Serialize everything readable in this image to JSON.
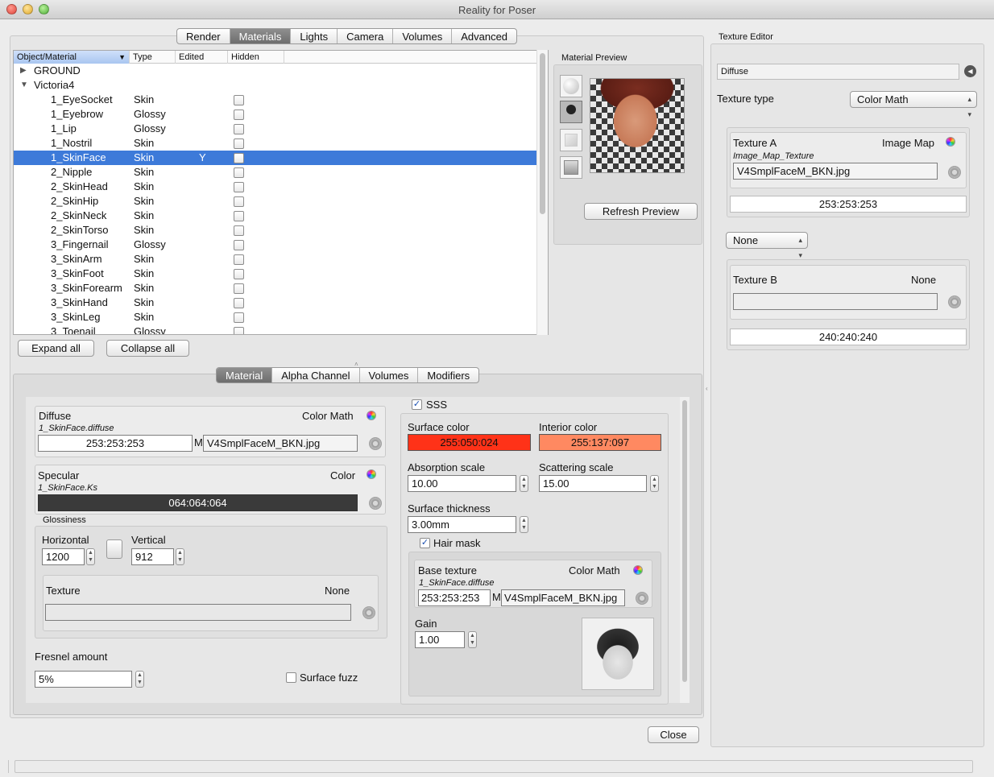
{
  "window": {
    "title": "Reality for Poser"
  },
  "top_tabs": [
    "Render",
    "Materials",
    "Lights",
    "Camera",
    "Volumes",
    "Advanced"
  ],
  "top_tabs_active": "Materials",
  "table": {
    "headers": [
      "Object/Material",
      "Type",
      "Edited",
      "Hidden"
    ],
    "groups": [
      {
        "name": "GROUND",
        "expanded": false
      },
      {
        "name": "Victoria4",
        "expanded": true
      }
    ],
    "rows": [
      {
        "name": "1_EyeSocket",
        "type": "Skin",
        "edited": ""
      },
      {
        "name": "1_Eyebrow",
        "type": "Glossy",
        "edited": ""
      },
      {
        "name": "1_Lip",
        "type": "Glossy",
        "edited": ""
      },
      {
        "name": "1_Nostril",
        "type": "Skin",
        "edited": ""
      },
      {
        "name": "1_SkinFace",
        "type": "Skin",
        "edited": "Y",
        "selected": true
      },
      {
        "name": "2_Nipple",
        "type": "Skin",
        "edited": ""
      },
      {
        "name": "2_SkinHead",
        "type": "Skin",
        "edited": ""
      },
      {
        "name": "2_SkinHip",
        "type": "Skin",
        "edited": ""
      },
      {
        "name": "2_SkinNeck",
        "type": "Skin",
        "edited": ""
      },
      {
        "name": "2_SkinTorso",
        "type": "Skin",
        "edited": ""
      },
      {
        "name": "3_Fingernail",
        "type": "Glossy",
        "edited": ""
      },
      {
        "name": "3_SkinArm",
        "type": "Skin",
        "edited": ""
      },
      {
        "name": "3_SkinFoot",
        "type": "Skin",
        "edited": ""
      },
      {
        "name": "3_SkinForearm",
        "type": "Skin",
        "edited": ""
      },
      {
        "name": "3_SkinHand",
        "type": "Skin",
        "edited": ""
      },
      {
        "name": "3_SkinLeg",
        "type": "Skin",
        "edited": ""
      },
      {
        "name": "3_Toenail",
        "type": "Glossy",
        "edited": ""
      }
    ]
  },
  "buttons": {
    "expand_all": "Expand all",
    "collapse_all": "Collapse all",
    "refresh_preview": "Refresh Preview",
    "close": "Close"
  },
  "material_preview": {
    "label": "Material Preview"
  },
  "sub_tabs": [
    "Material",
    "Alpha Channel",
    "Volumes",
    "Modifiers"
  ],
  "sub_tabs_active": "Material",
  "diffuse": {
    "label": "Diffuse",
    "mode": "Color Math",
    "path": "1_SkinFace.diffuse",
    "value": "253:253:253",
    "m": "M",
    "file": "V4SmplFaceM_BKN.jpg"
  },
  "specular": {
    "label": "Specular",
    "mode": "Color",
    "path": "1_SkinFace.Ks",
    "value": "064:064:064",
    "color": "#3a3a3a"
  },
  "glossiness": {
    "label": "Glossiness",
    "horizontal_label": "Horizontal",
    "horizontal": "1200",
    "vertical_label": "Vertical",
    "vertical": "912",
    "texture_label": "Texture",
    "texture_value": "None"
  },
  "fresnel": {
    "label": "Fresnel amount",
    "value": "5%"
  },
  "surface_fuzz": {
    "label": "Surface fuzz",
    "checked": false
  },
  "sss": {
    "label": "SSS",
    "checked": true,
    "surface_color_label": "Surface color",
    "surface_color": "255:050:024",
    "surface_hex": "#ff3218",
    "interior_color_label": "Interior color",
    "interior_color": "255:137:097",
    "interior_hex": "#ff8961",
    "absorption_label": "Absorption scale",
    "absorption": "10.00",
    "scattering_label": "Scattering scale",
    "scattering": "15.00",
    "thickness_label": "Surface thickness",
    "thickness": "3.00mm",
    "hair_mask_label": "Hair mask",
    "hair_mask": true,
    "base_texture_label": "Base texture",
    "base_mode": "Color Math",
    "base_path": "1_SkinFace.diffuse",
    "base_value": "253:253:253",
    "base_m": "M",
    "base_file": "V4SmplFaceM_BKN.jpg",
    "gain_label": "Gain",
    "gain": "1.00"
  },
  "texture_editor": {
    "title": "Texture Editor",
    "channel": "Diffuse",
    "type_label": "Texture type",
    "type_value": "Color Math",
    "texture_a_label": "Texture A",
    "texture_a_mode": "Image Map",
    "texture_a_sub": "Image_Map_Texture",
    "texture_a_file": "V4SmplFaceM_BKN.jpg",
    "texture_a_color": "253:253:253",
    "op_value": "None",
    "texture_b_label": "Texture B",
    "texture_b_mode": "None",
    "texture_b_color": "240:240:240"
  }
}
